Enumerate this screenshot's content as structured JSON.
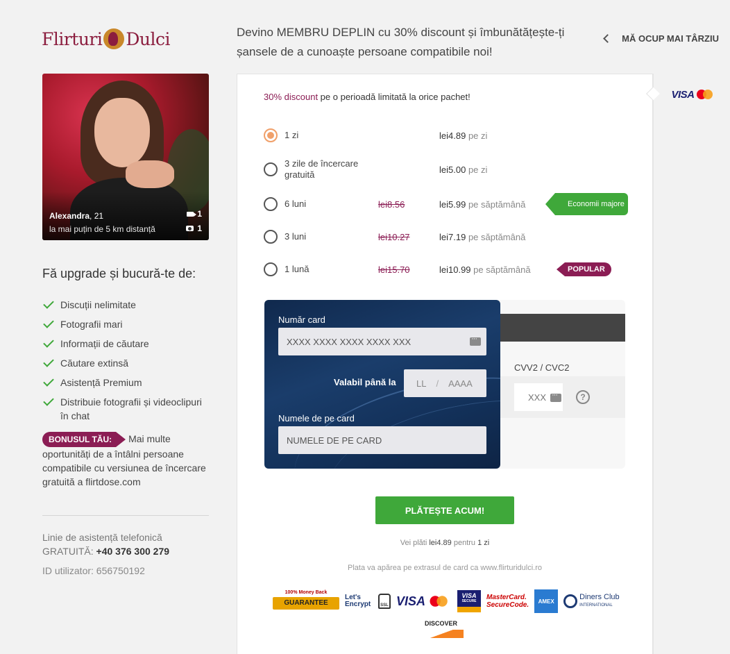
{
  "brand": {
    "name_part1": "Flirturi",
    "name_part2": "Dulci"
  },
  "header": {
    "headline": "Devino MEMBRU DEPLIN cu 30% discount și îmbunătățește-ți șansele de a cunoaște persoane compatibile noi!",
    "later_label": "MĂ OCUP MAI TÂRZIU"
  },
  "profile": {
    "name": "Alexandra",
    "age": ", 21",
    "distance": "la mai puțin de 5 km distanță",
    "videos": "1",
    "photos": "1"
  },
  "benefits": {
    "title": "Fă upgrade și bucură-te de:",
    "items": [
      "Discuții nelimitate",
      "Fotografii mari",
      "Informații de căutare",
      "Căutare extinsă",
      "Asistență Premium",
      "Distribuie fotografii și videoclipuri în chat"
    ]
  },
  "bonus": {
    "tag": "BONUSUL TĂU:",
    "text": "Mai multe oportunități de a întâlni persoane compatibile cu versiunea de încercare gratuită a flirtdose.com"
  },
  "support": {
    "line1": "Linie de asistență telefonică",
    "line2_prefix": "GRATUITĂ: ",
    "phone": "+40 376 300 279",
    "user_id": "ID utilizator: 656750192"
  },
  "promo": {
    "highlight": "30% discount",
    "rest": " pe o perioadă limitată la orice pachet!"
  },
  "plans": [
    {
      "name": "1 zi",
      "old": "",
      "price": "lei4.89",
      "unit": "pe zi",
      "selected": true,
      "flag": ""
    },
    {
      "name": "3 zile de încercare gratuită",
      "old": "",
      "price": "lei5.00",
      "unit": "pe zi",
      "selected": false,
      "flag": ""
    },
    {
      "name": "6 luni",
      "old": "lei8.56",
      "price": "lei5.99",
      "unit": "pe săptămână",
      "selected": false,
      "flag": "Economii majore"
    },
    {
      "name": "3 luni",
      "old": "lei10.27",
      "price": "lei7.19",
      "unit": "pe săptămână",
      "selected": false,
      "flag": ""
    },
    {
      "name": "1 lună",
      "old": "lei15.70",
      "price": "lei10.99",
      "unit": "pe săptămână",
      "selected": false,
      "flag": "POPULAR"
    }
  ],
  "card": {
    "number_label": "Număr card",
    "number_placeholder": "XXXX XXXX XXXX XXXX XXX",
    "valid_label": "Valabil până la",
    "month_placeholder": "LL",
    "sep": "/",
    "year_placeholder": "AAAA",
    "name_label": "Numele de pe card",
    "name_placeholder": "NUMELE DE PE CARD",
    "cvv_label": "CVV2 / CVC2",
    "cvv_placeholder": "XXX",
    "help": "?"
  },
  "pay": {
    "button": "PLĂTEȘTE ACUM!",
    "info_prefix": "Vei plăti ",
    "info_amount": "lei4.89",
    "info_mid": " pentru ",
    "info_period": "1 zi",
    "statement": "Plata va apărea pe extrasul de card ca www.flirturidulci.ro"
  },
  "side": {
    "visa": "VISA"
  },
  "badges": {
    "money_top": "100% Money Back",
    "money_main": "GUARANTEE",
    "letsencrypt": "Let's Encrypt",
    "ssl": "SSL",
    "visa": "VISA",
    "visa_secure_top": "VISA",
    "visa_secure_bottom": "SECURE",
    "mc_secure_1": "MasterCard.",
    "mc_secure_2": "SecureCode.",
    "amex": "AMEX",
    "diners_1": "Diners Club",
    "diners_2": "INTERNATIONAL",
    "discover": "DISCOVER"
  },
  "colors": {
    "accent": "#8b1d54",
    "green": "#3fa83a",
    "selected_radio": "#f0a06a",
    "card_navy": "#1a3d6b"
  }
}
